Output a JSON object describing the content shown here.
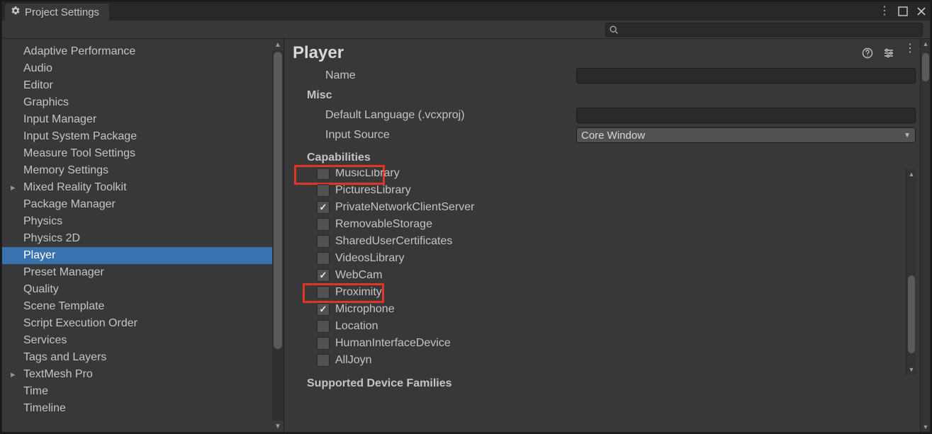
{
  "tab": {
    "title": "Project Settings"
  },
  "search": {
    "placeholder": ""
  },
  "sidebar": {
    "items": [
      {
        "label": "Adaptive Performance",
        "expand": false
      },
      {
        "label": "Audio",
        "expand": false
      },
      {
        "label": "Editor",
        "expand": false
      },
      {
        "label": "Graphics",
        "expand": false
      },
      {
        "label": "Input Manager",
        "expand": false
      },
      {
        "label": "Input System Package",
        "expand": false
      },
      {
        "label": "Measure Tool Settings",
        "expand": false
      },
      {
        "label": "Memory Settings",
        "expand": false
      },
      {
        "label": "Mixed Reality Toolkit",
        "expand": true
      },
      {
        "label": "Package Manager",
        "expand": false
      },
      {
        "label": "Physics",
        "expand": false
      },
      {
        "label": "Physics 2D",
        "expand": false
      },
      {
        "label": "Player",
        "expand": false,
        "selected": true
      },
      {
        "label": "Preset Manager",
        "expand": false
      },
      {
        "label": "Quality",
        "expand": false
      },
      {
        "label": "Scene Template",
        "expand": false
      },
      {
        "label": "Script Execution Order",
        "expand": false
      },
      {
        "label": "Services",
        "expand": false
      },
      {
        "label": "Tags and Layers",
        "expand": false
      },
      {
        "label": "TextMesh Pro",
        "expand": true
      },
      {
        "label": "Time",
        "expand": false
      },
      {
        "label": "Timeline",
        "expand": false
      }
    ]
  },
  "main": {
    "title": "Player",
    "name_row": {
      "label": "Name",
      "value": ""
    },
    "misc_label": "Misc",
    "default_lang": {
      "label": "Default Language (.vcxproj)",
      "value": ""
    },
    "input_source": {
      "label": "Input Source",
      "value": "Core Window"
    },
    "capabilities_label": "Capabilities",
    "capabilities": [
      {
        "label": "MusicLibrary",
        "checked": false
      },
      {
        "label": "PicturesLibrary",
        "checked": false
      },
      {
        "label": "PrivateNetworkClientServer",
        "checked": true
      },
      {
        "label": "RemovableStorage",
        "checked": false
      },
      {
        "label": "SharedUserCertificates",
        "checked": false
      },
      {
        "label": "VideosLibrary",
        "checked": false
      },
      {
        "label": "WebCam",
        "checked": true
      },
      {
        "label": "Proximity",
        "checked": false
      },
      {
        "label": "Microphone",
        "checked": true
      },
      {
        "label": "Location",
        "checked": false
      },
      {
        "label": "HumanInterfaceDevice",
        "checked": false
      },
      {
        "label": "AllJoyn",
        "checked": false
      }
    ],
    "supported_families_label": "Supported Device Families"
  }
}
